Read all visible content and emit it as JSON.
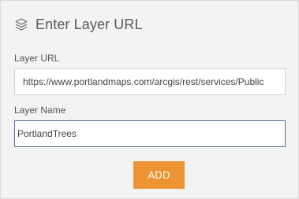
{
  "header": {
    "icon": "layers-icon",
    "title": "Enter Layer URL"
  },
  "form": {
    "url_label": "Layer URL",
    "url_value": "https://www.portlandmaps.com/arcgis/rest/services/Public",
    "name_label": "Layer Name",
    "name_value": "PortlandTrees",
    "add_label": "ADD"
  },
  "colors": {
    "accent": "#ec9332",
    "panel_background": "#f3f3f3",
    "focus_border": "#5b6f95"
  }
}
